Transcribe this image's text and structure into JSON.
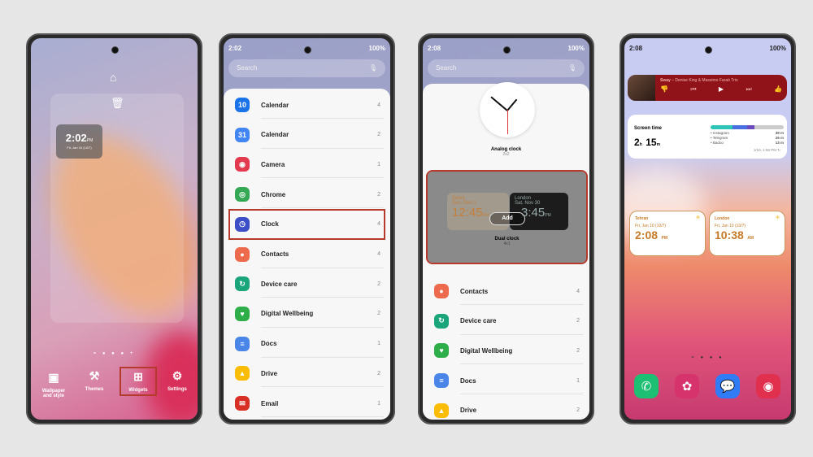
{
  "phone1": {
    "clock_time": "2:02",
    "clock_ampm": "PM",
    "clock_date": "Fri, Jan 10 (10/7)",
    "nav": [
      {
        "label": "Wallpaper and style",
        "icon": "image-icon"
      },
      {
        "label": "Themes",
        "icon": "brush-icon"
      },
      {
        "label": "Widgets",
        "icon": "widgets-icon"
      },
      {
        "label": "Settings",
        "icon": "gear-icon"
      }
    ]
  },
  "phone2": {
    "time": "2:02",
    "battery": "100%",
    "search_placeholder": "Search",
    "items": [
      {
        "label": "Calendar",
        "count": "4",
        "color": "#1a73e8",
        "glyph": "10"
      },
      {
        "label": "Calendar",
        "count": "2",
        "color": "#4285f4",
        "glyph": "31"
      },
      {
        "label": "Camera",
        "count": "1",
        "color": "#e33a50",
        "glyph": "◉"
      },
      {
        "label": "Chrome",
        "count": "2",
        "color": "#34a853",
        "glyph": "◎"
      },
      {
        "label": "Clock",
        "count": "4",
        "color": "#3c4fc7",
        "glyph": "◷"
      },
      {
        "label": "Contacts",
        "count": "4",
        "color": "#ee6a4c",
        "glyph": "●"
      },
      {
        "label": "Device care",
        "count": "2",
        "color": "#1aa67a",
        "glyph": "↻"
      },
      {
        "label": "Digital Wellbeing",
        "count": "2",
        "color": "#2dae48",
        "glyph": "♥"
      },
      {
        "label": "Docs",
        "count": "1",
        "color": "#4a86e8",
        "glyph": "≡"
      },
      {
        "label": "Drive",
        "count": "2",
        "color": "#fbbc04",
        "glyph": "▲"
      },
      {
        "label": "Email",
        "count": "1",
        "color": "#d93025",
        "glyph": "✉"
      }
    ]
  },
  "phone3": {
    "time": "2:08",
    "battery": "100%",
    "search_placeholder": "Search",
    "analog": {
      "label": "Analog clock",
      "size": "2x2"
    },
    "dual": {
      "label": "Dual clock",
      "size": "4x1",
      "add": "Add",
      "city1": "Seoul",
      "date1": "Sun, Dec 1",
      "time1": "12:45",
      "ampm1": "AM",
      "city2": "London",
      "date2": "Sat, Nov 30",
      "time2": "3:45",
      "ampm2": "PM"
    },
    "items": [
      {
        "label": "Contacts",
        "count": "4",
        "color": "#ee6a4c",
        "glyph": "●"
      },
      {
        "label": "Device care",
        "count": "2",
        "color": "#1aa67a",
        "glyph": "↻"
      },
      {
        "label": "Digital Wellbeing",
        "count": "2",
        "color": "#2dae48",
        "glyph": "♥"
      },
      {
        "label": "Docs",
        "count": "1",
        "color": "#4a86e8",
        "glyph": "≡"
      },
      {
        "label": "Drive",
        "count": "2",
        "color": "#fbbc04",
        "glyph": "▲"
      }
    ]
  },
  "phone4": {
    "time": "2:08",
    "battery": "100%",
    "music": {
      "title": "Sway",
      "artist": "Denise King & Massimo Faraò Trio"
    },
    "screen_time": {
      "label": "Screen time",
      "hours": "2",
      "h": "h",
      "minutes": "15",
      "m": "m",
      "apps": [
        {
          "name": "Instagram",
          "time": "39 m"
        },
        {
          "name": "Telegram",
          "time": "26 m"
        },
        {
          "name": "Badoo",
          "time": "13 m"
        }
      ],
      "updated": "1/10, 1:59 PM"
    },
    "clocks": [
      {
        "city": "Tehran",
        "date": "Fri, Jan 10 (10/7)",
        "time": "2:08",
        "ampm": "PM"
      },
      {
        "city": "London",
        "date": "Fri, Jan 10 (10/7)",
        "time": "10:38",
        "ampm": "AM"
      }
    ],
    "dock": [
      {
        "icon": "phone-icon",
        "color": "#1dbf73",
        "glyph": "✆"
      },
      {
        "icon": "gallery-icon",
        "color": "#d6336c",
        "glyph": "✿"
      },
      {
        "icon": "messages-icon",
        "color": "#2f7cf6",
        "glyph": "💬"
      },
      {
        "icon": "camera-icon",
        "color": "#e0304e",
        "glyph": "◉"
      }
    ]
  },
  "colors": {
    "highlight": "#b43a2e",
    "music_bg": "#8f1318",
    "accent_orange": "#c77b2a"
  }
}
